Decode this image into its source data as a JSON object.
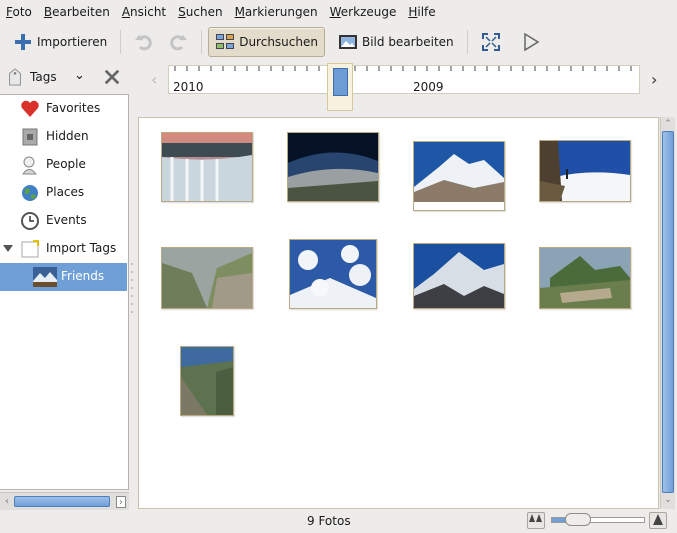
{
  "menubar": {
    "items": [
      {
        "mnemonic": "F",
        "rest": "oto"
      },
      {
        "mnemonic": "B",
        "rest": "earbeiten"
      },
      {
        "mnemonic": "A",
        "rest": "nsicht"
      },
      {
        "mnemonic": "S",
        "rest": "uchen"
      },
      {
        "mnemonic": "M",
        "rest": "arkierungen"
      },
      {
        "mnemonic": "W",
        "rest": "erkzeuge"
      },
      {
        "mnemonic": "H",
        "rest": "ilfe"
      }
    ]
  },
  "toolbar": {
    "import_label": "Importieren",
    "browse_label": "Durchsuchen",
    "edit_label": "Bild bearbeiten"
  },
  "tags": {
    "label": "Tags",
    "items": [
      {
        "label": "Favorites"
      },
      {
        "label": "Hidden"
      },
      {
        "label": "People"
      },
      {
        "label": "Places"
      },
      {
        "label": "Events"
      },
      {
        "label": "Import Tags"
      },
      {
        "label": "Friends"
      }
    ]
  },
  "timeline": {
    "year_left": "2010",
    "year_right": "2009"
  },
  "status": {
    "photo_count": "9 Fotos",
    "zoom_level": 0.2
  },
  "colors": {
    "selection": "#6e9fd6",
    "active_button": "#e4dccb"
  }
}
